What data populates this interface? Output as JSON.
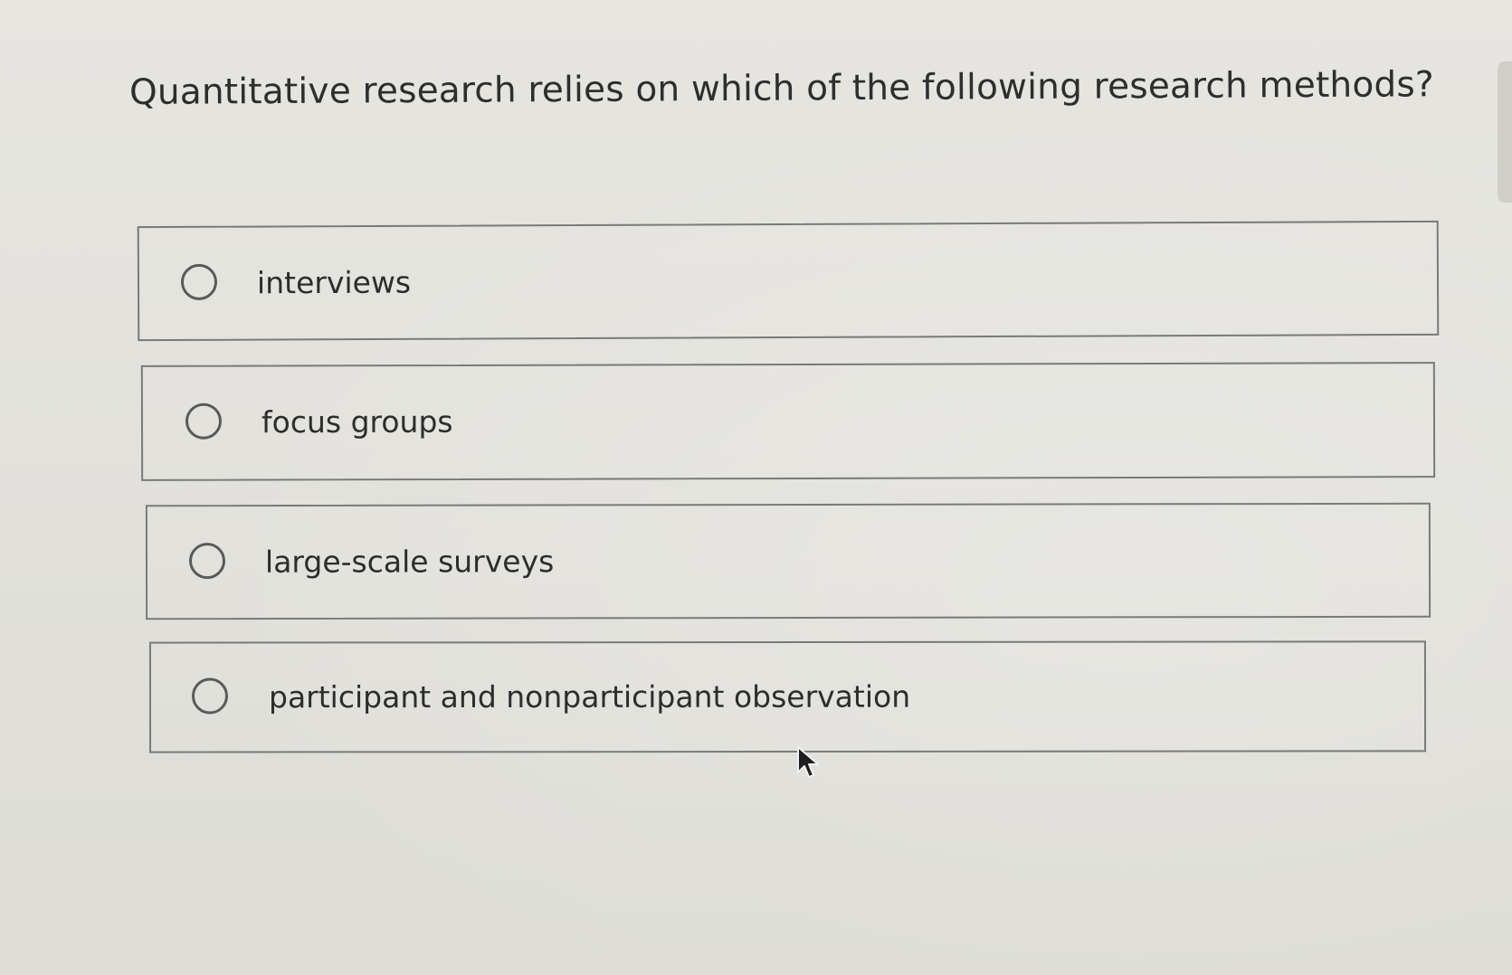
{
  "question": {
    "text": "Quantitative research relies on which of the following research methods?"
  },
  "options": [
    {
      "label": "interviews",
      "selected": false
    },
    {
      "label": "focus groups",
      "selected": false
    },
    {
      "label": "large-scale surveys",
      "selected": false
    },
    {
      "label": "participant and nonparticipant observation",
      "selected": false
    }
  ],
  "icons": {
    "radio": "radio-button-unchecked-icon",
    "cursor": "mouse-pointer-arrow-icon"
  },
  "colors": {
    "background": "#e3e2dd",
    "border": "#7a7a78",
    "text": "#2d2d2d"
  }
}
